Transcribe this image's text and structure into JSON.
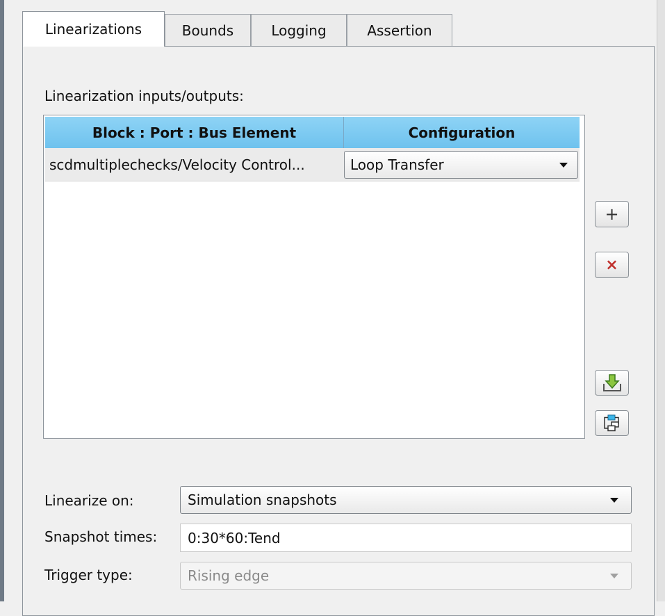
{
  "tabs": [
    {
      "label": "Linearizations",
      "active": true
    },
    {
      "label": "Bounds",
      "active": false
    },
    {
      "label": "Logging",
      "active": false
    },
    {
      "label": "Assertion",
      "active": false
    }
  ],
  "io_section": {
    "label": "Linearization inputs/outputs:",
    "columns": [
      "Block : Port : Bus Element",
      "Configuration"
    ],
    "rows": [
      {
        "block": "scdmultiplechecks/Velocity Control...",
        "configuration": "Loop Transfer"
      }
    ],
    "header_color": "#7fcbf2"
  },
  "side_buttons": {
    "add": {
      "glyph": "+",
      "icon": "plus-icon"
    },
    "remove": {
      "glyph": "×",
      "icon": "close-icon",
      "color": "#c0302c"
    },
    "import": {
      "icon": "import-arrow-icon"
    },
    "highlight": {
      "icon": "block-diagram-icon"
    }
  },
  "form": {
    "linearize_on": {
      "label": "Linearize on:",
      "value": "Simulation snapshots"
    },
    "snapshot_times": {
      "label": "Snapshot times:",
      "value": "0:30*60:Tend"
    },
    "trigger_type": {
      "label": "Trigger type:",
      "value": "Rising edge",
      "disabled": true
    }
  }
}
